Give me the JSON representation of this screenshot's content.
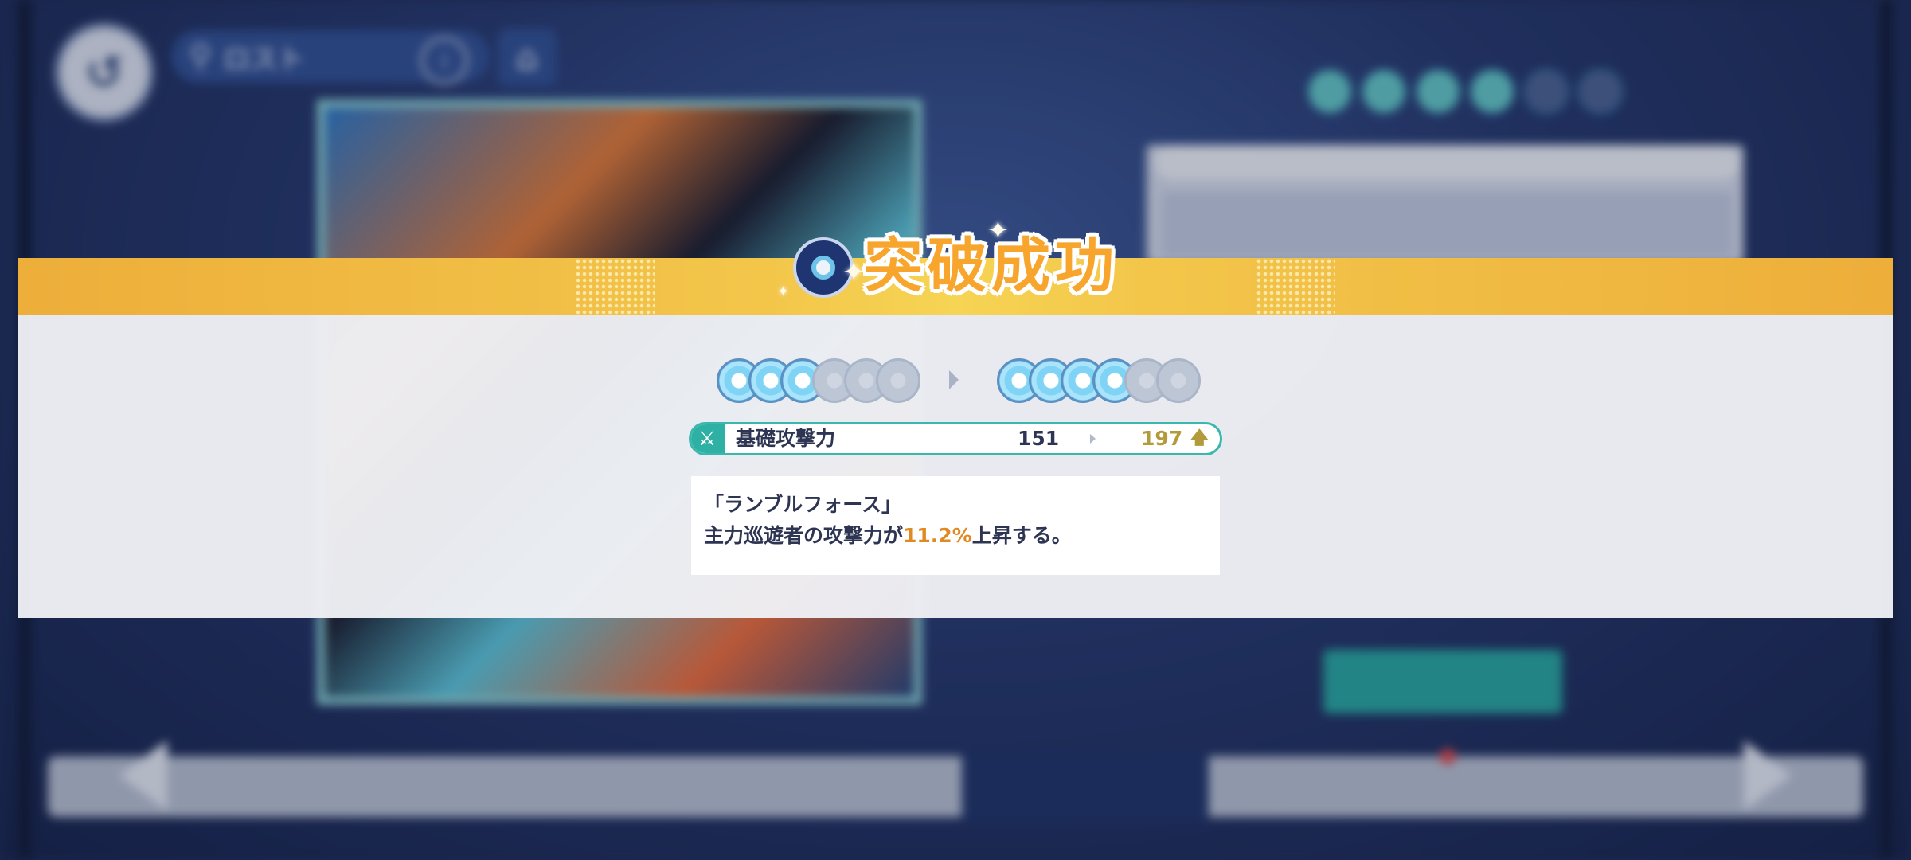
{
  "background": {
    "location_label": "ロスト",
    "icons": [
      "back-icon",
      "pin-icon",
      "info-icon",
      "home-icon"
    ]
  },
  "popup": {
    "title": "突破成功",
    "rarity_before": {
      "filled": 3,
      "total": 6
    },
    "rarity_after": {
      "filled": 4,
      "total": 6
    },
    "stat": {
      "name": "基礎攻撃力",
      "old_value": "151",
      "new_value": "197",
      "up_icon": "🡅"
    },
    "skill": {
      "name": "「ランブルフォース」",
      "desc_prefix": "主力巡遊者の攻撃力が",
      "desc_value": "11.2%",
      "desc_suffix": "上昇する。"
    }
  },
  "colors": {
    "banner": "#f3c64a",
    "title": "#f7a52c",
    "stat_border": "#3bb8ad",
    "highlight": "#e08a23",
    "new_value": "#b39a3b"
  }
}
